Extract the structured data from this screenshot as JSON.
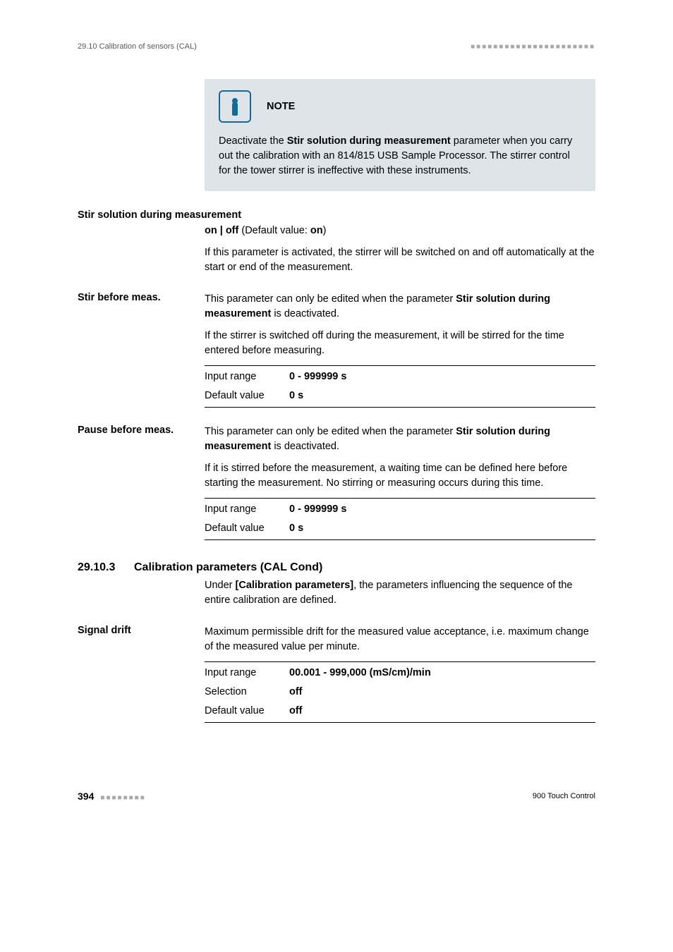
{
  "runningHeader": {
    "section": "29.10 Calibration of sensors (CAL)",
    "dashes": "■■■■■■■■■■■■■■■■■■■■■■"
  },
  "note": {
    "title": "NOTE",
    "body_pre": "Deactivate the ",
    "body_bold": "Stir solution during measurement",
    "body_post": " parameter when you carry out the calibration with an 814/815 USB Sample Processor. The stirrer control for the tower stirrer is ineffective with these instruments."
  },
  "params": {
    "stirDuring": {
      "label": "Stir solution during measurement",
      "options": "on | off",
      "defaultText": " (Default value: ",
      "defaultVal": "on",
      "closingParen": ")",
      "desc": "If this parameter is activated, the stirrer will be switched on and off automatically at the start or end of the measurement."
    },
    "stirBefore": {
      "label": "Stir before meas.",
      "para1_pre": "This parameter can only be edited when the parameter ",
      "para1_bold": "Stir solution during measurement",
      "para1_post": " is deactivated.",
      "para2": "If the stirrer is switched off during the measurement, it will be stirred for the time entered before measuring.",
      "table": {
        "k1": "Input range",
        "v1": "0 - 999999 s",
        "k2": "Default value",
        "v2": "0 s"
      }
    },
    "pauseBefore": {
      "label": "Pause before meas.",
      "para1_pre": "This parameter can only be edited when the parameter ",
      "para1_bold": "Stir solution during measurement",
      "para1_post": " is deactivated.",
      "para2": "If it is stirred before the measurement, a waiting time can be defined here before starting the measurement. No stirring or measuring occurs during this time.",
      "table": {
        "k1": "Input range",
        "v1": "0 - 999999 s",
        "k2": "Default value",
        "v2": "0 s"
      }
    },
    "signalDrift": {
      "label": "Signal drift",
      "desc": "Maximum permissible drift for the measured value acceptance, i.e. maximum change of the measured value per minute.",
      "table": {
        "k1": "Input range",
        "v1": "00.001 - 999,000 (mS/cm)/min",
        "k2": "Selection",
        "v2": "off",
        "k3": "Default value",
        "v3": "off"
      }
    }
  },
  "section": {
    "num": "29.10.3",
    "title": "Calibration parameters (CAL Cond)",
    "intro_pre": "Under ",
    "intro_bold": "[Calibration parameters]",
    "intro_post": ", the parameters influencing the sequence of the entire calibration are defined."
  },
  "footer": {
    "page": "394",
    "dashes": "■■■■■■■■",
    "product": "900 Touch Control"
  }
}
